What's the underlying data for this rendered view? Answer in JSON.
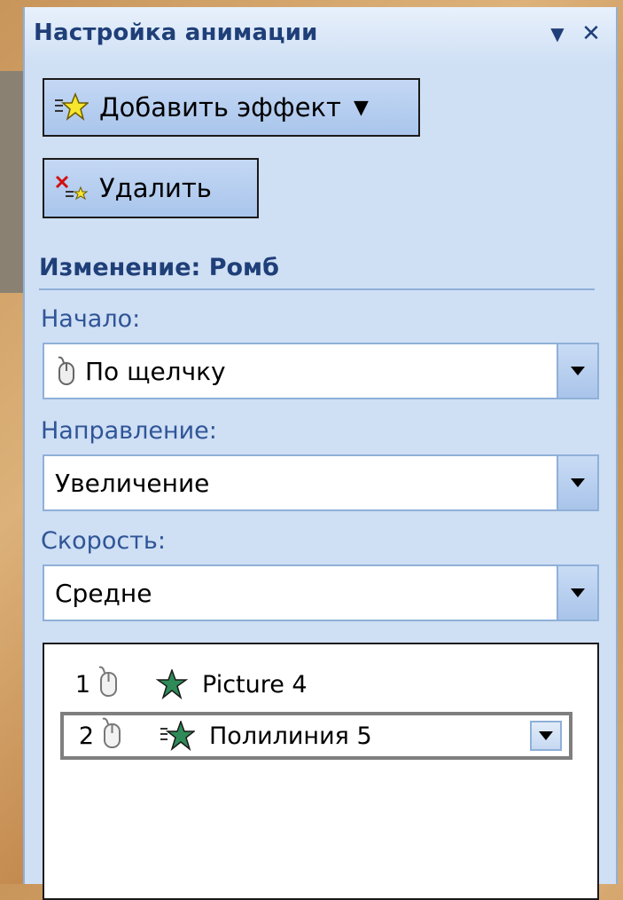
{
  "panel": {
    "title": "Настройка анимации",
    "title_color": "#1f3f78",
    "dropdown_icon": "chevron-down-icon",
    "close_icon": "close-icon"
  },
  "toolbar": {
    "add_effect_label": "Добавить эффект",
    "add_effect_icon": "add-effect-star-icon",
    "delete_label": "Удалить",
    "delete_icon": "delete-effect-icon"
  },
  "section": {
    "title": "Изменение: Ромб"
  },
  "fields": {
    "start": {
      "label": "Начало:",
      "value": "По щелчку",
      "icon": "mouse-icon"
    },
    "direction": {
      "label": "Направление:",
      "value": "Увеличение"
    },
    "speed": {
      "label": "Скорость:",
      "value": "Средне"
    }
  },
  "effects": [
    {
      "number": "1",
      "trigger_icon": "mouse-icon",
      "effect_icon": "star-icon",
      "name": "Picture 4",
      "selected": false
    },
    {
      "number": "2",
      "trigger_icon": "mouse-icon",
      "effect_icon": "star-icon",
      "name": "Полилиния 5",
      "selected": true
    }
  ],
  "colors": {
    "panel_bg": "#cfdff4",
    "accent_text": "#1f3f78",
    "label_text": "#2f5597",
    "button_bg": "#b5cdf0",
    "star_green": "#2e8b57"
  }
}
